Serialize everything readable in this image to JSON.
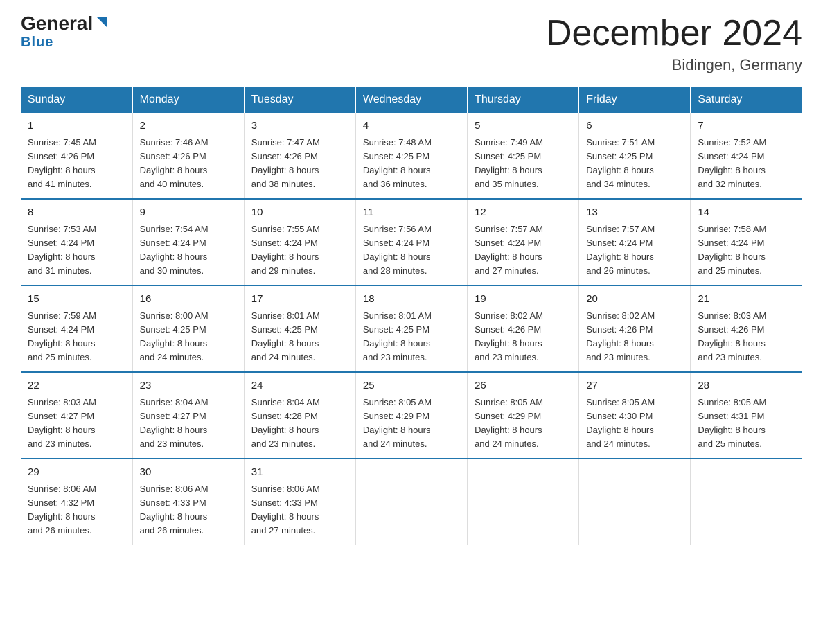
{
  "header": {
    "logo_general": "General",
    "logo_blue": "Blue",
    "main_title": "December 2024",
    "subtitle": "Bidingen, Germany"
  },
  "days_of_week": [
    "Sunday",
    "Monday",
    "Tuesday",
    "Wednesday",
    "Thursday",
    "Friday",
    "Saturday"
  ],
  "weeks": [
    [
      {
        "day": "1",
        "info": "Sunrise: 7:45 AM\nSunset: 4:26 PM\nDaylight: 8 hours\nand 41 minutes."
      },
      {
        "day": "2",
        "info": "Sunrise: 7:46 AM\nSunset: 4:26 PM\nDaylight: 8 hours\nand 40 minutes."
      },
      {
        "day": "3",
        "info": "Sunrise: 7:47 AM\nSunset: 4:26 PM\nDaylight: 8 hours\nand 38 minutes."
      },
      {
        "day": "4",
        "info": "Sunrise: 7:48 AM\nSunset: 4:25 PM\nDaylight: 8 hours\nand 36 minutes."
      },
      {
        "day": "5",
        "info": "Sunrise: 7:49 AM\nSunset: 4:25 PM\nDaylight: 8 hours\nand 35 minutes."
      },
      {
        "day": "6",
        "info": "Sunrise: 7:51 AM\nSunset: 4:25 PM\nDaylight: 8 hours\nand 34 minutes."
      },
      {
        "day": "7",
        "info": "Sunrise: 7:52 AM\nSunset: 4:24 PM\nDaylight: 8 hours\nand 32 minutes."
      }
    ],
    [
      {
        "day": "8",
        "info": "Sunrise: 7:53 AM\nSunset: 4:24 PM\nDaylight: 8 hours\nand 31 minutes."
      },
      {
        "day": "9",
        "info": "Sunrise: 7:54 AM\nSunset: 4:24 PM\nDaylight: 8 hours\nand 30 minutes."
      },
      {
        "day": "10",
        "info": "Sunrise: 7:55 AM\nSunset: 4:24 PM\nDaylight: 8 hours\nand 29 minutes."
      },
      {
        "day": "11",
        "info": "Sunrise: 7:56 AM\nSunset: 4:24 PM\nDaylight: 8 hours\nand 28 minutes."
      },
      {
        "day": "12",
        "info": "Sunrise: 7:57 AM\nSunset: 4:24 PM\nDaylight: 8 hours\nand 27 minutes."
      },
      {
        "day": "13",
        "info": "Sunrise: 7:57 AM\nSunset: 4:24 PM\nDaylight: 8 hours\nand 26 minutes."
      },
      {
        "day": "14",
        "info": "Sunrise: 7:58 AM\nSunset: 4:24 PM\nDaylight: 8 hours\nand 25 minutes."
      }
    ],
    [
      {
        "day": "15",
        "info": "Sunrise: 7:59 AM\nSunset: 4:24 PM\nDaylight: 8 hours\nand 25 minutes."
      },
      {
        "day": "16",
        "info": "Sunrise: 8:00 AM\nSunset: 4:25 PM\nDaylight: 8 hours\nand 24 minutes."
      },
      {
        "day": "17",
        "info": "Sunrise: 8:01 AM\nSunset: 4:25 PM\nDaylight: 8 hours\nand 24 minutes."
      },
      {
        "day": "18",
        "info": "Sunrise: 8:01 AM\nSunset: 4:25 PM\nDaylight: 8 hours\nand 23 minutes."
      },
      {
        "day": "19",
        "info": "Sunrise: 8:02 AM\nSunset: 4:26 PM\nDaylight: 8 hours\nand 23 minutes."
      },
      {
        "day": "20",
        "info": "Sunrise: 8:02 AM\nSunset: 4:26 PM\nDaylight: 8 hours\nand 23 minutes."
      },
      {
        "day": "21",
        "info": "Sunrise: 8:03 AM\nSunset: 4:26 PM\nDaylight: 8 hours\nand 23 minutes."
      }
    ],
    [
      {
        "day": "22",
        "info": "Sunrise: 8:03 AM\nSunset: 4:27 PM\nDaylight: 8 hours\nand 23 minutes."
      },
      {
        "day": "23",
        "info": "Sunrise: 8:04 AM\nSunset: 4:27 PM\nDaylight: 8 hours\nand 23 minutes."
      },
      {
        "day": "24",
        "info": "Sunrise: 8:04 AM\nSunset: 4:28 PM\nDaylight: 8 hours\nand 23 minutes."
      },
      {
        "day": "25",
        "info": "Sunrise: 8:05 AM\nSunset: 4:29 PM\nDaylight: 8 hours\nand 24 minutes."
      },
      {
        "day": "26",
        "info": "Sunrise: 8:05 AM\nSunset: 4:29 PM\nDaylight: 8 hours\nand 24 minutes."
      },
      {
        "day": "27",
        "info": "Sunrise: 8:05 AM\nSunset: 4:30 PM\nDaylight: 8 hours\nand 24 minutes."
      },
      {
        "day": "28",
        "info": "Sunrise: 8:05 AM\nSunset: 4:31 PM\nDaylight: 8 hours\nand 25 minutes."
      }
    ],
    [
      {
        "day": "29",
        "info": "Sunrise: 8:06 AM\nSunset: 4:32 PM\nDaylight: 8 hours\nand 26 minutes."
      },
      {
        "day": "30",
        "info": "Sunrise: 8:06 AM\nSunset: 4:33 PM\nDaylight: 8 hours\nand 26 minutes."
      },
      {
        "day": "31",
        "info": "Sunrise: 8:06 AM\nSunset: 4:33 PM\nDaylight: 8 hours\nand 27 minutes."
      },
      {
        "day": "",
        "info": ""
      },
      {
        "day": "",
        "info": ""
      },
      {
        "day": "",
        "info": ""
      },
      {
        "day": "",
        "info": ""
      }
    ]
  ]
}
